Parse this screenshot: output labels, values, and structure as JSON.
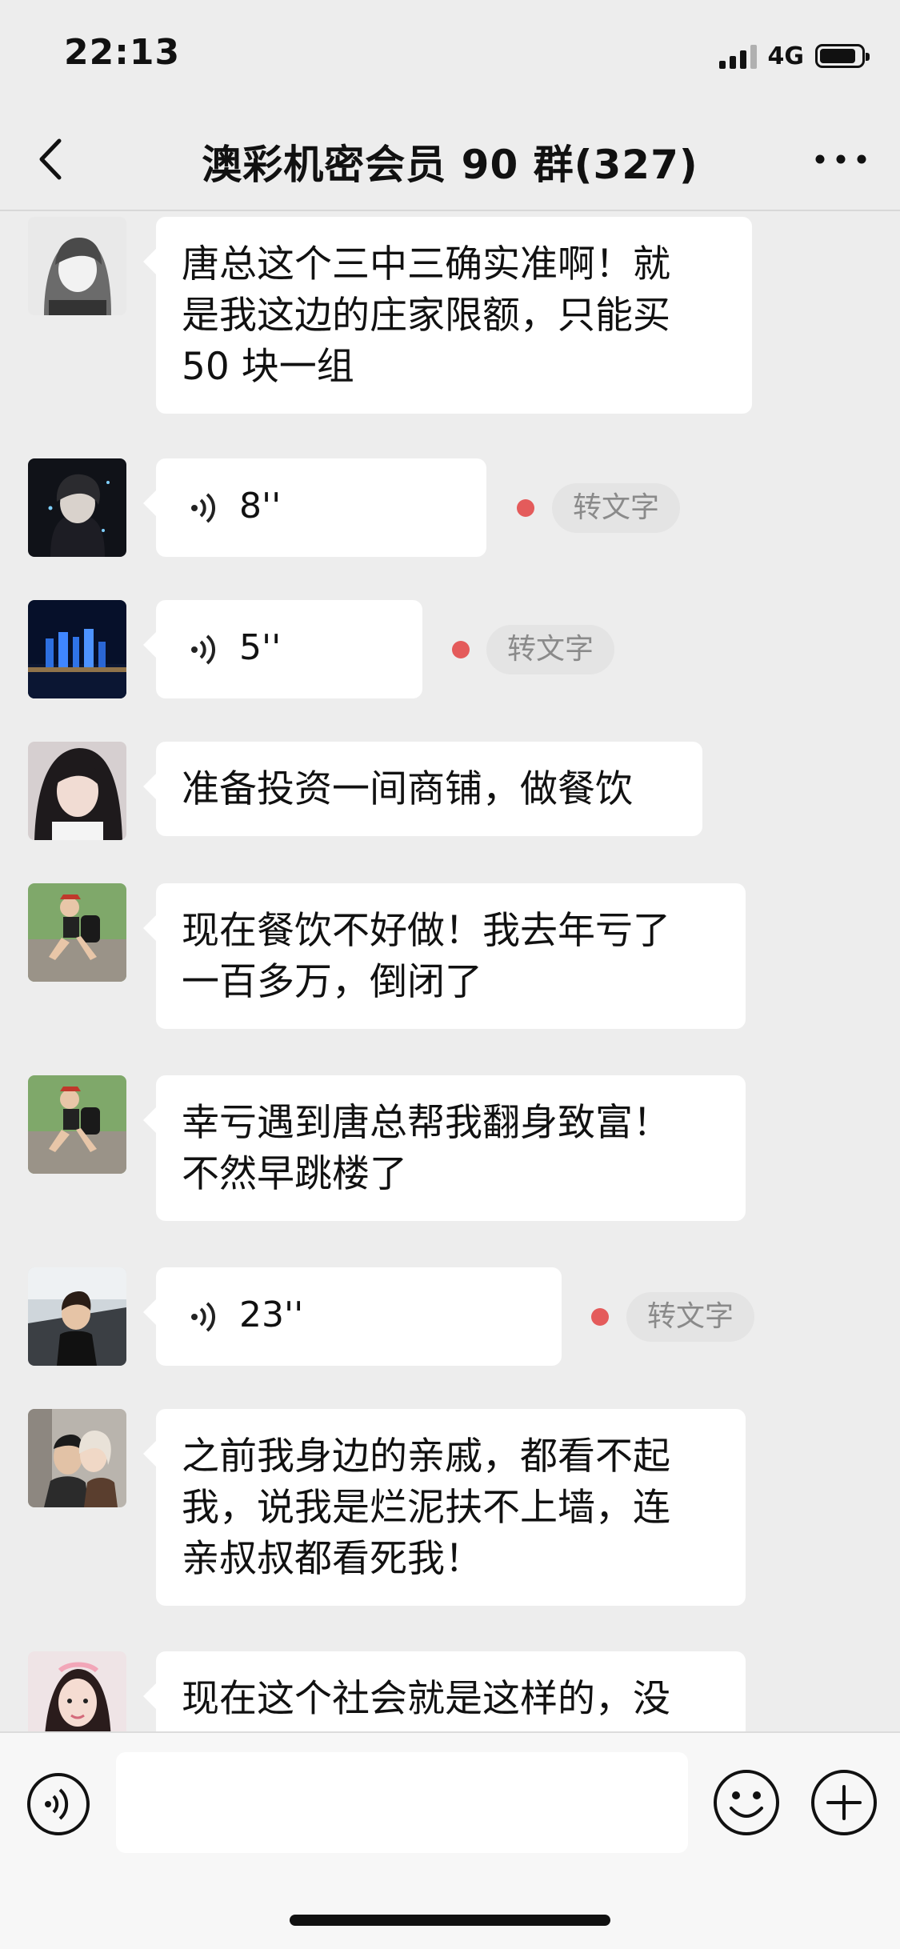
{
  "status_bar": {
    "time": "22:13",
    "network": "4G"
  },
  "header": {
    "title": "澳彩机密会员 90 群(327)"
  },
  "messages": [
    {
      "type": "text",
      "avatar": "avatar-gray-haired-woman",
      "text": "唐总这个三中三确实准啊！就\n是我这边的庄家限额，只能买\n50 块一组"
    },
    {
      "type": "voice",
      "avatar": "avatar-anime-boy",
      "duration": "8''",
      "convert_label": "转文字",
      "unread": true
    },
    {
      "type": "voice",
      "avatar": "avatar-city-night",
      "duration": "5''",
      "convert_label": "转文字",
      "unread": true
    },
    {
      "type": "text",
      "avatar": "avatar-woman-portrait",
      "text": "准备投资一间商铺，做餐饮"
    },
    {
      "type": "text",
      "avatar": "avatar-hiker-woman",
      "text": "现在餐饮不好做！我去年亏了\n一百多万，倒闭了"
    },
    {
      "type": "text",
      "avatar": "avatar-hiker-woman",
      "text": "幸亏遇到唐总帮我翻身致富！\n不然早跳楼了"
    },
    {
      "type": "voice",
      "avatar": "avatar-child-in-car",
      "duration": "23''",
      "convert_label": "转文字",
      "unread": true
    },
    {
      "type": "text",
      "avatar": "avatar-couple",
      "text": "之前我身边的亲戚，都看不起\n我，说我是烂泥扶不上墙，连\n亲叔叔都看死我！"
    },
    {
      "type": "text",
      "avatar": "avatar-girl-headband",
      "text": "现在这个社会就是这样的，没"
    }
  ],
  "input": {
    "placeholder": ""
  },
  "icons": {
    "back": "chevron-left-icon",
    "more": "more-dots-icon",
    "voice_toggle": "voice-icon",
    "emoji": "smiley-icon",
    "plus": "plus-icon"
  },
  "colors": {
    "background": "#ededed",
    "bubble": "#ffffff",
    "unread_dot": "#e45b5b"
  }
}
